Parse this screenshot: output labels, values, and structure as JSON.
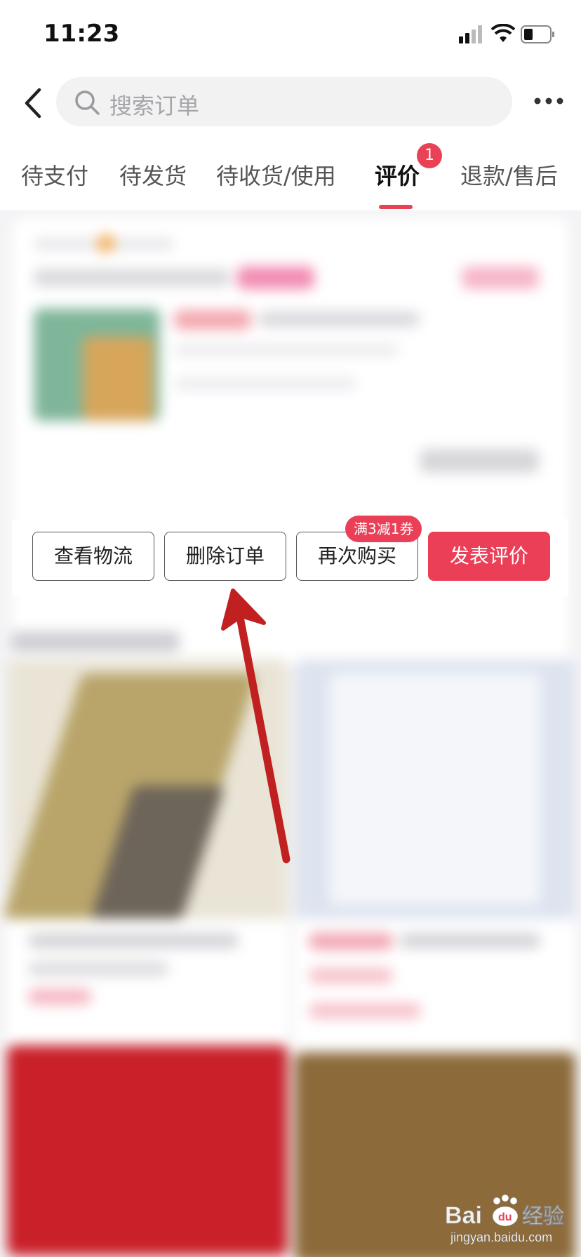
{
  "status_bar": {
    "time": "11:23"
  },
  "search": {
    "placeholder": "搜索订单"
  },
  "tabs": [
    {
      "label": "待支付"
    },
    {
      "label": "待发货"
    },
    {
      "label": "待收货/使用"
    },
    {
      "label": "评价",
      "active": true,
      "badge": "1"
    },
    {
      "label": "退款/售后"
    }
  ],
  "order_actions": {
    "view_logistics": "查看物流",
    "delete_order": "删除订单",
    "buy_again": "再次购买",
    "write_review": "发表评价",
    "coupon_tag": "满3减1券"
  },
  "watermark": {
    "brand": "Bai du 经验",
    "site": "jingyan.baidu.com"
  },
  "colors": {
    "accent": "#ea3f56",
    "background": "#f4f4f6"
  },
  "icons": [
    "back-icon",
    "search-icon",
    "more-icon",
    "signal-icon",
    "wifi-icon",
    "battery-icon"
  ]
}
